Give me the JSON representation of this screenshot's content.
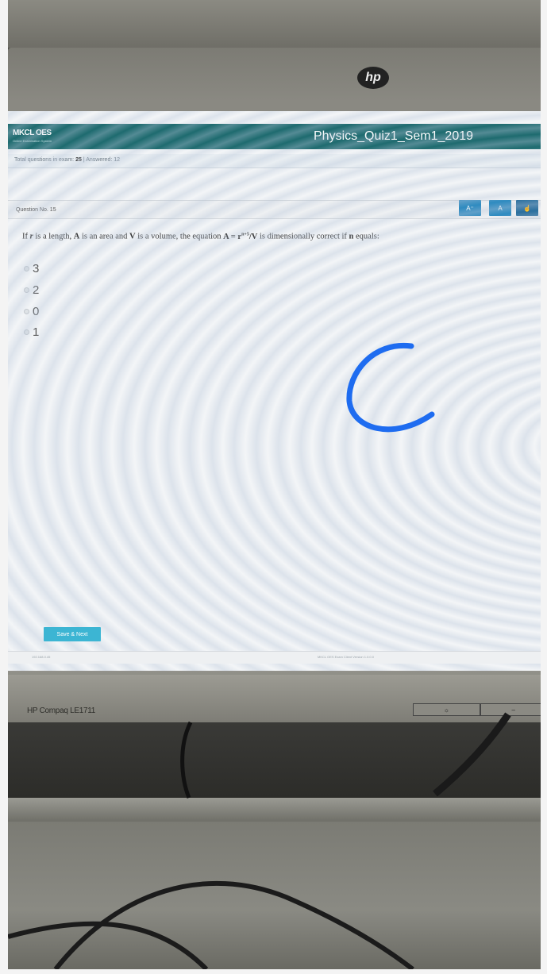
{
  "app": {
    "brand": "MKCL OES",
    "brand_subtitle": "Online Examination System",
    "exam_title": "Physics_Quiz1_Sem1_2019"
  },
  "stats": {
    "total_label": "Total questions in exam:",
    "total_value": "25",
    "separator": "|",
    "answered_label": "Answered:",
    "answered_value": "12"
  },
  "question": {
    "number_label": "Question No. 15",
    "text_part1": "If ",
    "r": "r",
    "text_part2": " is a length, ",
    "A": "A",
    "text_part3": " is an area and ",
    "V": "V",
    "text_part4": " is a volume, the equation ",
    "equation": "A = r",
    "exponent": "n+5",
    "equation_tail": "/V",
    "text_part5": " is dimensionally correct if ",
    "n": "n",
    "text_part6": " equals:"
  },
  "toolbar": {
    "font_decrease_label": "A⁻",
    "font_normal_label": "A",
    "hand_icon": "hand-pointer-icon"
  },
  "options": [
    "3",
    "2",
    "0",
    "1"
  ],
  "actions": {
    "save_next_label": "Save & Next"
  },
  "footer": {
    "left_text": "192.168.0.45",
    "center_text": "MKCL OES Exam Client Version 1.0.0.0"
  },
  "monitor": {
    "brand_logo": "hp",
    "model": "HP Compaq LE1711",
    "button_glyph": "☼",
    "button_minus": "–"
  },
  "colors": {
    "topbar": "#1e6b6f",
    "button_blue": "#2f8bc0",
    "save_button": "#3cb5d3",
    "annotation_stroke": "#1e6cf0"
  }
}
